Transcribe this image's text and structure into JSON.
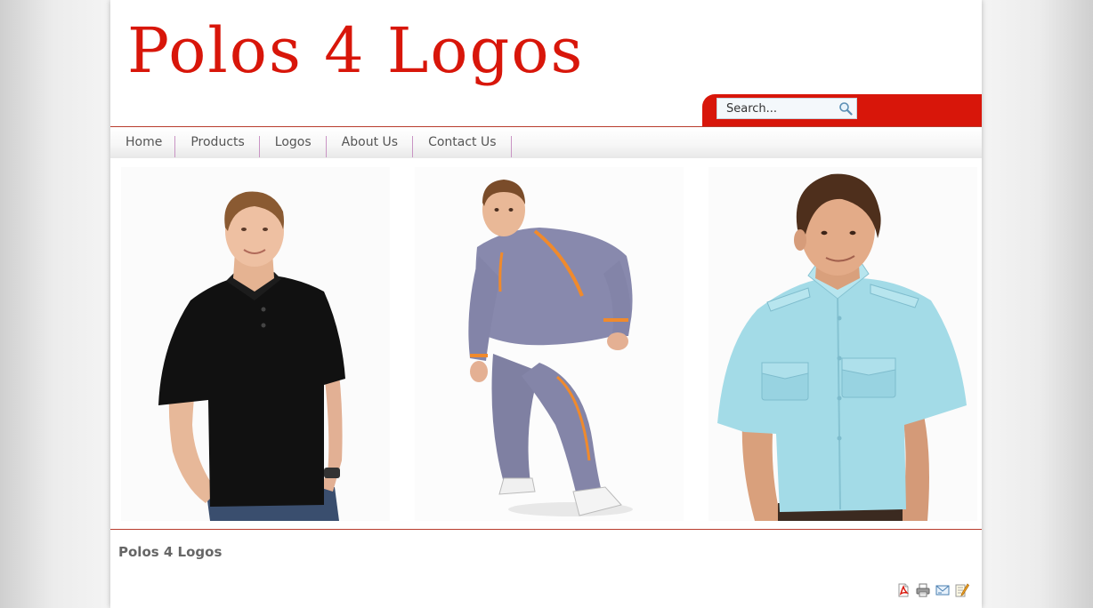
{
  "site": {
    "title": "Polos 4 Logos",
    "brand_color": "#d8160a",
    "rule_color": "#b83c2e",
    "nav_separator_color": "#c994c4"
  },
  "search": {
    "placeholder": "Search...",
    "icon": "magnifier-icon"
  },
  "nav": {
    "items": [
      {
        "label": "Home"
      },
      {
        "label": "Products"
      },
      {
        "label": "Logos"
      },
      {
        "label": "About Us"
      },
      {
        "label": "Contact Us"
      }
    ]
  },
  "gallery": {
    "images": [
      {
        "subject": "man in black polo shirt"
      },
      {
        "subject": "man in grey and orange tracksuit"
      },
      {
        "subject": "man in light blue short-sleeve shirt"
      }
    ]
  },
  "content": {
    "title": "Polos 4 Logos"
  },
  "tools": [
    {
      "icon": "pdf-icon"
    },
    {
      "icon": "print-icon"
    },
    {
      "icon": "email-icon"
    },
    {
      "icon": "edit-icon"
    }
  ]
}
